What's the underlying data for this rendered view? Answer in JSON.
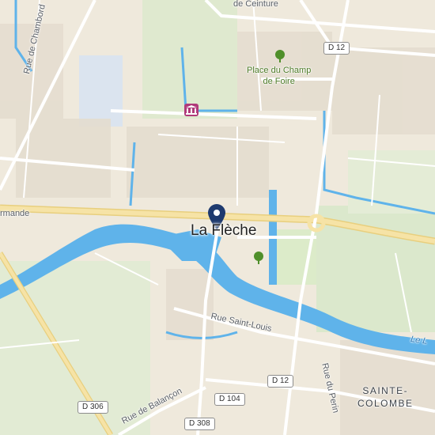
{
  "map": {
    "city_label": "La Flèche",
    "district_label_line1": "SAINTE-",
    "district_label_line2": "COLOMBE",
    "park_label_line1": "Place du Champ",
    "park_label_line2": "de Foire",
    "streets": {
      "ceinture": "de Ceinture",
      "chambord": "Rue de Chambord",
      "rmande": "rmande",
      "saint_louis": "Rue Saint-Louis",
      "balancon": "Rue de Balançon",
      "perin": "Rue du Perin",
      "loir": "Le L"
    },
    "road_shields": {
      "d12_top": "D 12",
      "d12_bottom": "D 12",
      "d104": "D 104",
      "d306": "D 306",
      "d308": "D 308"
    },
    "icons": [
      "map-pin-icon",
      "museum-icon",
      "tree-icon"
    ],
    "colors": {
      "land": "#efe9dc",
      "water": "#5fb3ea",
      "park": "#d8e8c5",
      "main_road": "#f6e3a6",
      "minor_road": "#ffffff",
      "pin": "#1e3a6e"
    }
  }
}
